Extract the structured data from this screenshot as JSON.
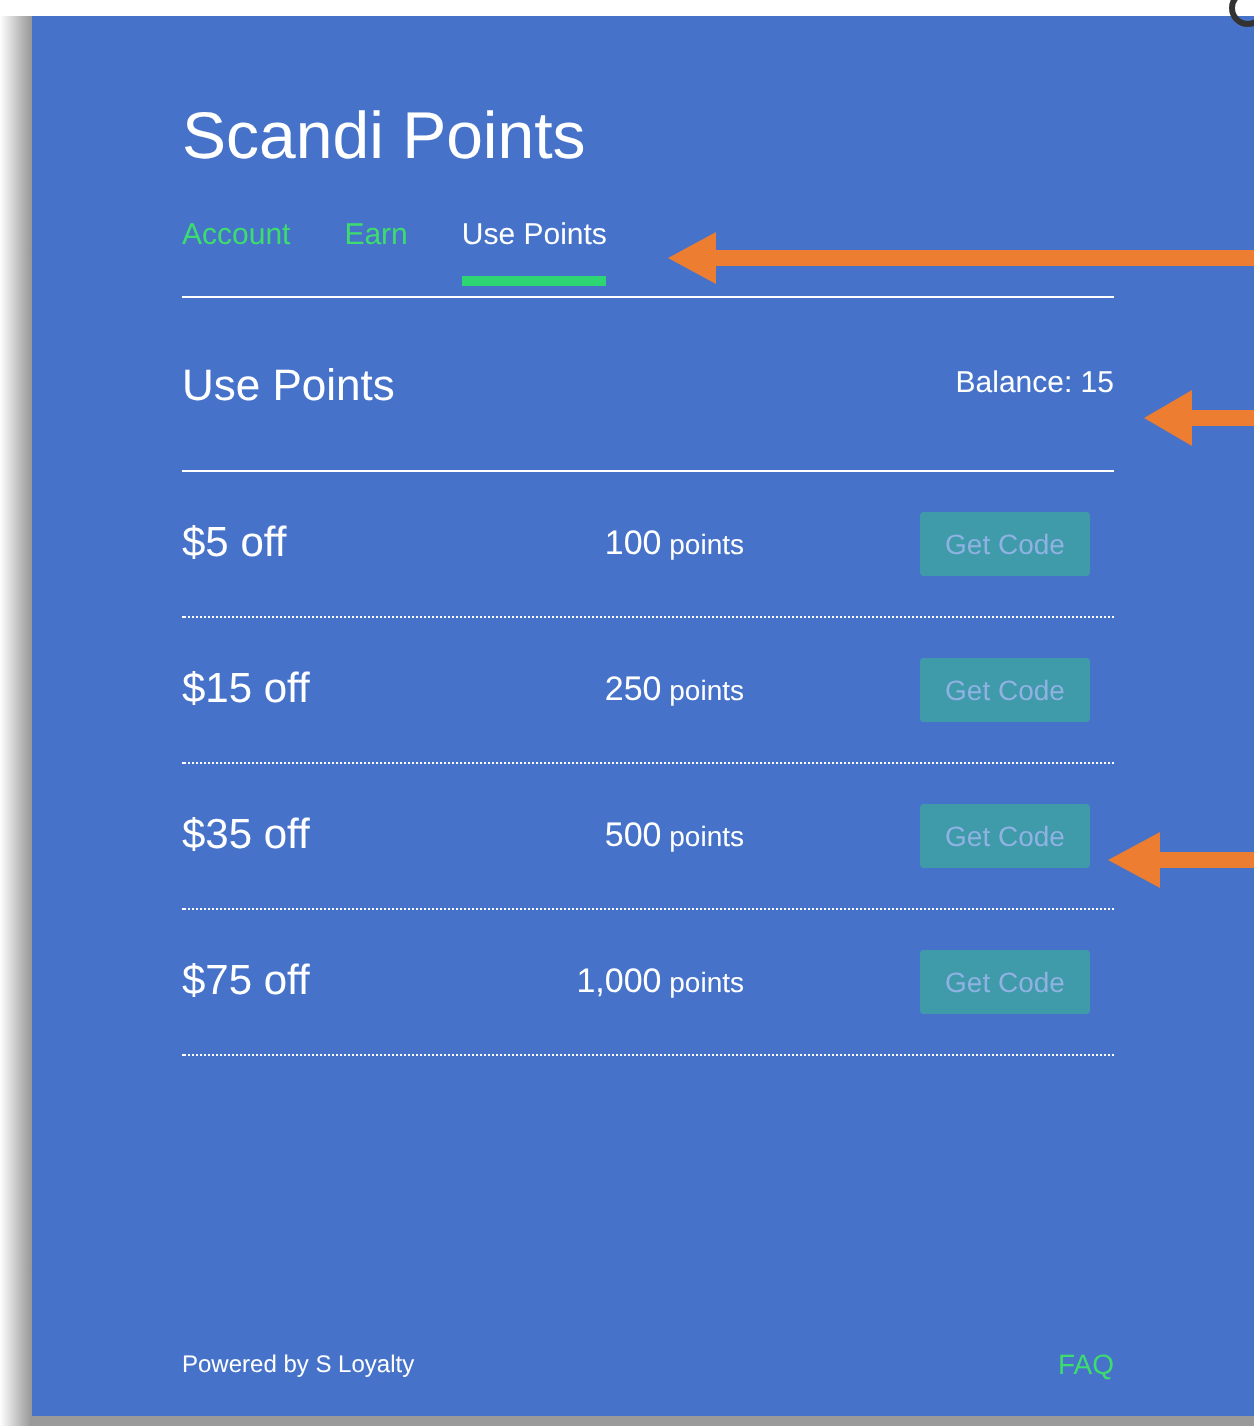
{
  "title": "Scandi Points",
  "tabs": [
    {
      "label": "Account",
      "selected": false
    },
    {
      "label": "Earn",
      "selected": false
    },
    {
      "label": "Use Points",
      "selected": true
    }
  ],
  "section": {
    "title": "Use Points",
    "balance": "Balance: 15"
  },
  "rewards": [
    {
      "reward": "$5 off",
      "points": "100",
      "unit": "points",
      "button": "Get Code",
      "disabled": true
    },
    {
      "reward": "$15 off",
      "points": "250",
      "unit": "points",
      "button": "Get Code",
      "disabled": true
    },
    {
      "reward": "$35 off",
      "points": "500",
      "unit": "points",
      "button": "Get Code",
      "disabled": true
    },
    {
      "reward": "$75 off",
      "points": "1,000",
      "unit": "points",
      "button": "Get Code",
      "disabled": true
    }
  ],
  "footer": {
    "powered_by": "Powered by S Loyalty",
    "link": "FAQ"
  }
}
